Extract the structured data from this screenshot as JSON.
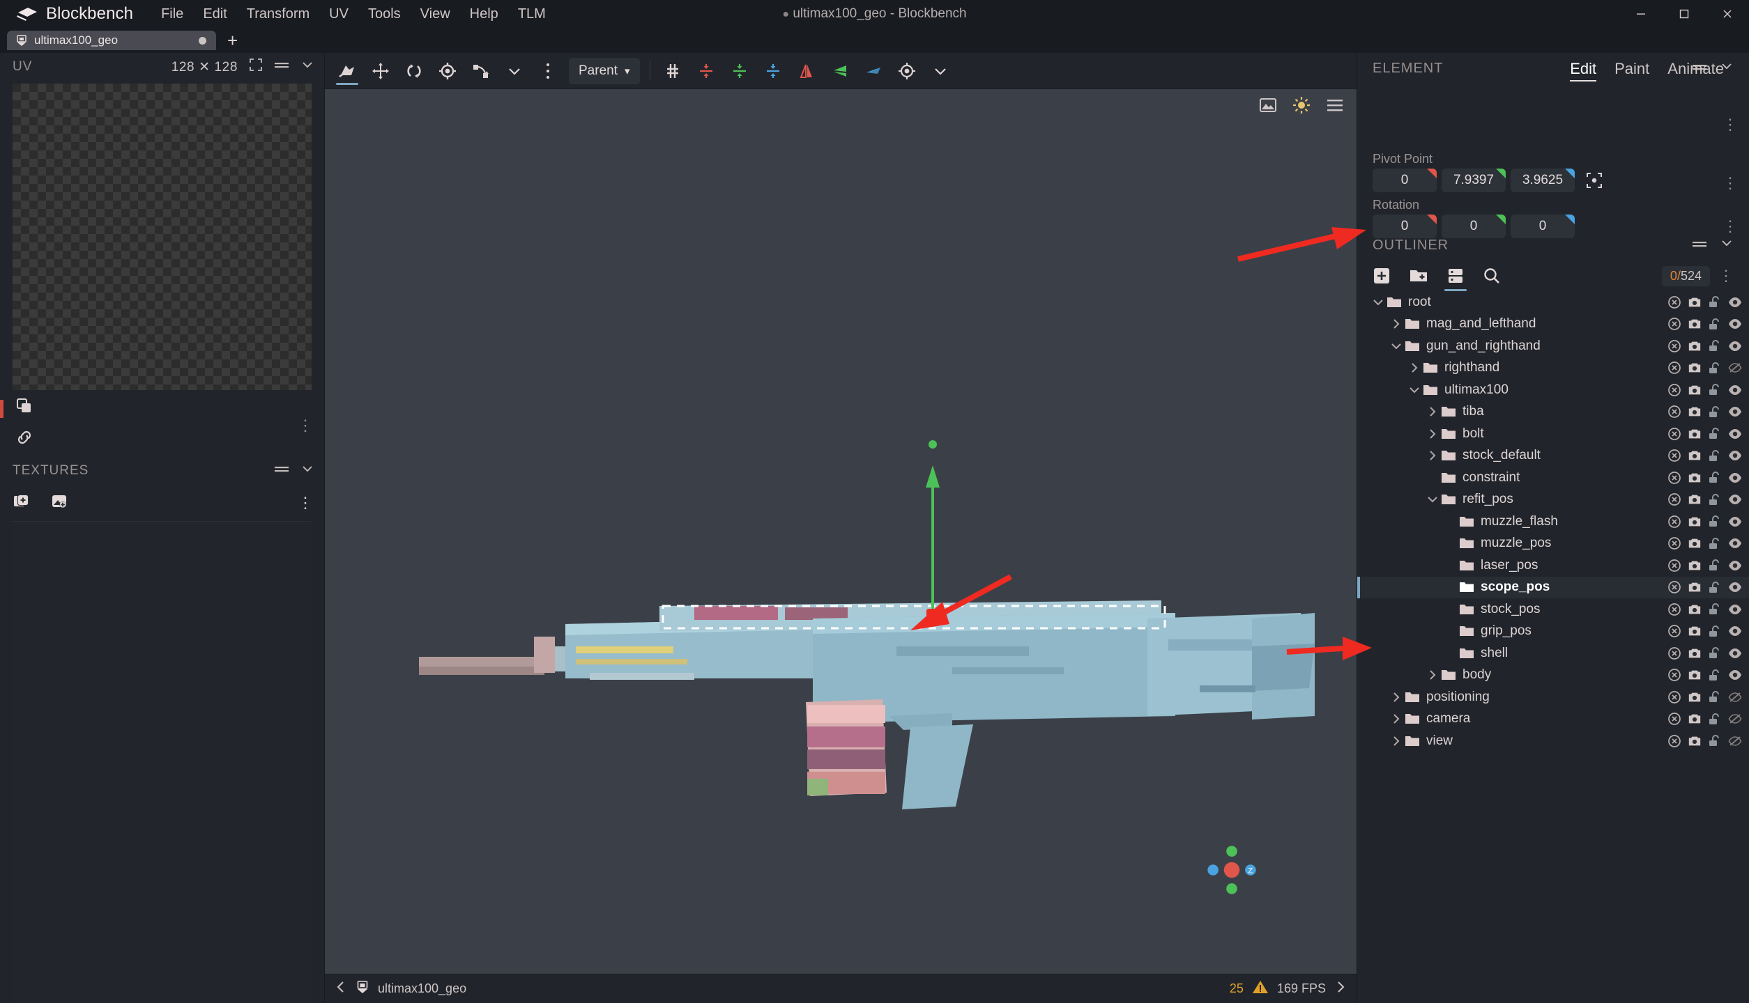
{
  "app": {
    "name": "Blockbench",
    "window_title": "ultimax100_geo - Blockbench",
    "window_title_dot": "●",
    "logo_icon": "blockbench-logo-icon"
  },
  "menu": {
    "items": [
      {
        "label": "File"
      },
      {
        "label": "Edit"
      },
      {
        "label": "Transform"
      },
      {
        "label": "UV"
      },
      {
        "label": "Tools"
      },
      {
        "label": "View"
      },
      {
        "label": "Help"
      },
      {
        "label": "TLM"
      }
    ]
  },
  "window_controls": {
    "minimize": "–",
    "maximize": "☐",
    "close": "✕"
  },
  "tabs": {
    "open": [
      {
        "label": "ultimax100_geo",
        "modified": true,
        "icon": "model-file-icon"
      }
    ],
    "add_label": "+"
  },
  "uv_panel": {
    "title": "UV",
    "size": "128 ✕ 128",
    "expand_icon": "fullscreen-icon",
    "menu_icon": "slider-menu-icon",
    "collapse_icon": "chevron-down-icon",
    "tools": [
      {
        "name": "copy-uv-icon"
      },
      {
        "name": "link-uv-icon"
      }
    ],
    "kebab": "⋮"
  },
  "textures_panel": {
    "title": "TEXTURES",
    "menu_icon": "slider-menu-icon",
    "collapse_icon": "chevron-down-icon",
    "tools": [
      {
        "name": "add-texture-icon"
      },
      {
        "name": "import-image-icon"
      }
    ],
    "kebab": "⋮",
    "items": []
  },
  "toolbar": {
    "tools": [
      {
        "name": "pivot-tool-icon",
        "active": true
      },
      {
        "name": "move-tool-icon",
        "active": false
      },
      {
        "name": "rotate-tool-icon",
        "active": false
      },
      {
        "name": "pivot-point-tool-icon",
        "active": false
      },
      {
        "name": "resize-tool-icon",
        "active": false
      },
      {
        "name": "chevron-down-icon",
        "active": false
      },
      {
        "name": "kebab-menu-icon",
        "active": false
      }
    ],
    "parent_select": {
      "label": "Parent",
      "chevron": "▾"
    },
    "axis_tools": [
      {
        "name": "center-all-icon",
        "color": "#ded3d3"
      },
      {
        "name": "center-x-icon",
        "color": "#e0564a"
      },
      {
        "name": "center-y-icon",
        "color": "#4cc157"
      },
      {
        "name": "center-z-icon",
        "color": "#4aa3e0"
      },
      {
        "name": "flip-x-icon",
        "color": "#e0564a"
      },
      {
        "name": "flip-y-icon",
        "color": "#4cc157"
      },
      {
        "name": "flip-z-icon",
        "color": "#4aa3e0"
      },
      {
        "name": "origin-icon",
        "color": "#ded3d3"
      },
      {
        "name": "chevron-down-icon",
        "color": "#ded3d3"
      }
    ]
  },
  "mode_tabs": [
    {
      "label": "Edit",
      "active": true
    },
    {
      "label": "Paint",
      "active": false
    },
    {
      "label": "Animate",
      "active": false
    }
  ],
  "viewport": {
    "corner_icons": [
      {
        "name": "background-image-icon"
      },
      {
        "name": "sun-light-icon"
      },
      {
        "name": "viewport-menu-icon"
      }
    ],
    "axis_widget": {
      "x_label": "",
      "z_label": "Z"
    },
    "model_name": "ultimax100_geo",
    "back_icon": "chevron-left-icon",
    "model_icon": "model-file-icon",
    "warning_count": "25",
    "warning_icon": "warning-triangle-icon",
    "fps": "169 FPS",
    "forward_icon": "chevron-right-icon"
  },
  "element_panel": {
    "title": "ELEMENT",
    "menu_icon": "slider-menu-icon",
    "collapse_icon": "chevron-down-icon",
    "kebab": "⋮",
    "pivot": {
      "label": "Pivot Point",
      "x": "0",
      "y": "7.9397",
      "z": "3.9625",
      "focus_icon": "focus-pivot-icon"
    },
    "rotation": {
      "label": "Rotation",
      "x": "0",
      "y": "0",
      "z": "0"
    }
  },
  "outliner": {
    "title": "OUTLINER",
    "menu_icon": "slider-menu-icon",
    "collapse_icon": "chevron-down-icon",
    "tools": [
      {
        "name": "add-cube-icon",
        "active": false
      },
      {
        "name": "add-group-icon",
        "active": false
      },
      {
        "name": "toggle-list-icon",
        "active": true
      },
      {
        "name": "search-icon",
        "active": false
      }
    ],
    "counter": {
      "selected": "0",
      "separator": "/",
      "total": "524"
    },
    "kebab": "⋮",
    "rows": [
      {
        "label": "root",
        "depth": 0,
        "caret": "down",
        "selected": false,
        "eye": "visible"
      },
      {
        "label": "mag_and_lefthand",
        "depth": 1,
        "caret": "right",
        "selected": false,
        "eye": "visible"
      },
      {
        "label": "gun_and_righthand",
        "depth": 1,
        "caret": "down",
        "selected": false,
        "eye": "visible"
      },
      {
        "label": "righthand",
        "depth": 2,
        "caret": "right",
        "selected": false,
        "eye": "hidden"
      },
      {
        "label": "ultimax100",
        "depth": 2,
        "caret": "down",
        "selected": false,
        "eye": "visible"
      },
      {
        "label": "tiba",
        "depth": 3,
        "caret": "right",
        "selected": false,
        "eye": "visible"
      },
      {
        "label": "bolt",
        "depth": 3,
        "caret": "right",
        "selected": false,
        "eye": "visible"
      },
      {
        "label": "stock_default",
        "depth": 3,
        "caret": "right",
        "selected": false,
        "eye": "visible"
      },
      {
        "label": "constraint",
        "depth": 3,
        "caret": "none",
        "selected": false,
        "eye": "visible"
      },
      {
        "label": "refit_pos",
        "depth": 3,
        "caret": "down",
        "selected": false,
        "eye": "visible"
      },
      {
        "label": "muzzle_flash",
        "depth": 4,
        "caret": "none",
        "selected": false,
        "eye": "visible"
      },
      {
        "label": "muzzle_pos",
        "depth": 4,
        "caret": "none",
        "selected": false,
        "eye": "visible"
      },
      {
        "label": "laser_pos",
        "depth": 4,
        "caret": "none",
        "selected": false,
        "eye": "visible"
      },
      {
        "label": "scope_pos",
        "depth": 4,
        "caret": "none",
        "selected": true,
        "eye": "visible"
      },
      {
        "label": "stock_pos",
        "depth": 4,
        "caret": "none",
        "selected": false,
        "eye": "visible"
      },
      {
        "label": "grip_pos",
        "depth": 4,
        "caret": "none",
        "selected": false,
        "eye": "visible"
      },
      {
        "label": "shell",
        "depth": 4,
        "caret": "none",
        "selected": false,
        "eye": "visible"
      },
      {
        "label": "body",
        "depth": 3,
        "caret": "right",
        "selected": false,
        "eye": "visible"
      },
      {
        "label": "positioning",
        "depth": 1,
        "caret": "right",
        "selected": false,
        "eye": "hidden"
      },
      {
        "label": "camera",
        "depth": 1,
        "caret": "right",
        "selected": false,
        "eye": "hidden"
      },
      {
        "label": "view",
        "depth": 1,
        "caret": "right",
        "selected": false,
        "eye": "hidden"
      }
    ],
    "row_action_icons": [
      "export-toggle-icon",
      "camera-toggle-icon",
      "lock-toggle-icon",
      "visibility-toggle-icon"
    ]
  },
  "annotations": {
    "arrow_color": "#ef2a21",
    "arrows": [
      {
        "name": "arrow-to-pivot-point-field"
      },
      {
        "name": "arrow-to-viewport-pivot"
      },
      {
        "name": "arrow-to-scope-pos-row"
      }
    ]
  },
  "colors": {
    "background": "#21252b",
    "titlebar": "#181b20",
    "viewport": "#3b4048",
    "accent_blue": "#7ea6c0",
    "axis_x": "#e0564a",
    "axis_y": "#4cc157",
    "axis_z": "#4aa3e0",
    "warning": "#e0a12a",
    "model_blue": "#8fbfd0"
  }
}
